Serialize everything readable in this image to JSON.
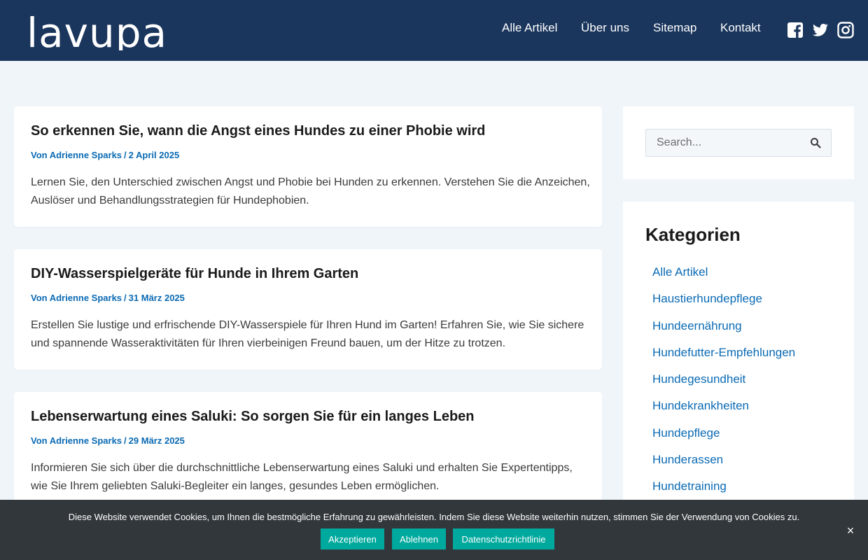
{
  "header": {
    "logo_text": "lavupa",
    "nav": [
      {
        "label": "Alle Artikel"
      },
      {
        "label": "Über uns"
      },
      {
        "label": "Sitemap"
      },
      {
        "label": "Kontakt"
      }
    ],
    "social": [
      {
        "icon": "facebook-icon"
      },
      {
        "icon": "twitter-icon"
      },
      {
        "icon": "instagram-icon"
      }
    ],
    "background_color": "#1b365d"
  },
  "posts": [
    {
      "title": "So erkennen Sie, wann die Angst eines Hundes zu einer Phobie wird",
      "author": "Von Adrienne Sparks",
      "separator": "/",
      "date": "2 April 2025",
      "excerpt": "Lernen Sie, den Unterschied zwischen Angst und Phobie bei Hunden zu erkennen. Verstehen Sie die Anzeichen, Auslöser und Behandlungsstrategien für Hundephobien."
    },
    {
      "title": "DIY-Wasserspielgeräte für Hunde in Ihrem Garten",
      "author": "Von Adrienne Sparks",
      "separator": "/",
      "date": "31 März 2025",
      "excerpt": "Erstellen Sie lustige und erfrischende DIY-Wasserspiele für Ihren Hund im Garten! Erfahren Sie, wie Sie sichere und spannende Wasseraktivitäten für Ihren vierbeinigen Freund bauen, um der Hitze zu trotzen."
    },
    {
      "title": "Lebenserwartung eines Saluki: So sorgen Sie für ein langes Leben",
      "author": "Von Adrienne Sparks",
      "separator": "/",
      "date": "29 März 2025",
      "excerpt": "Informieren Sie sich über die durchschnittliche Lebenserwartung eines Saluki und erhalten Sie Expertentipps, wie Sie Ihrem geliebten Saluki-Begleiter ein langes, gesundes Leben ermöglichen."
    }
  ],
  "sidebar": {
    "search": {
      "placeholder": "Search...",
      "button_icon": "search-icon"
    },
    "categories": {
      "title": "Kategorien",
      "items": [
        {
          "label": "Alle Artikel"
        },
        {
          "label": "Haustierhundepflege"
        },
        {
          "label": "Hundeernährung"
        },
        {
          "label": "Hundefutter-Empfehlungen"
        },
        {
          "label": "Hundegesundheit"
        },
        {
          "label": "Hundekrankheiten"
        },
        {
          "label": "Hundepflege"
        },
        {
          "label": "Hunderassen"
        },
        {
          "label": "Hundetraining"
        }
      ]
    }
  },
  "cookie_bar": {
    "text": "Diese Website verwendet Cookies, um Ihnen die bestmögliche Erfahrung zu gewährleisten. Indem Sie diese Website weiterhin nutzen, stimmen Sie der Verwendung von Cookies zu.",
    "accept_label": "Akzeptieren",
    "decline_label": "Ablehnen",
    "privacy_label": "Datenschutzrichtlinie",
    "close_label": "×",
    "button_color": "#00a99d",
    "background_color": "#32373c"
  },
  "colors": {
    "link": "#0a6ab4",
    "page_background": "#f0f5fa"
  }
}
